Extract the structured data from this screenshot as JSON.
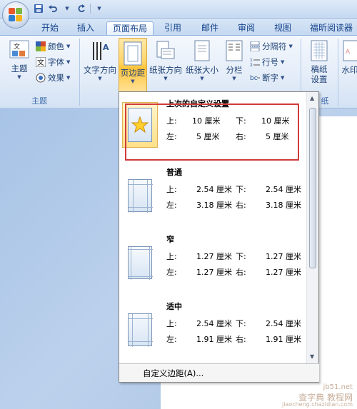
{
  "tabs": [
    "开始",
    "插入",
    "页面布局",
    "引用",
    "邮件",
    "审阅",
    "视图",
    "福昕阅读器"
  ],
  "active_tab": "页面布局",
  "ribbon": {
    "theme_button": "主题",
    "theme_items": [
      "颜色",
      "字体",
      "效果"
    ],
    "theme_group_label": "主题",
    "text_direction": "文字方向",
    "margins": "页边距",
    "orientation": "纸张方向",
    "size": "纸张大小",
    "columns": "分栏",
    "breaks": "分隔符",
    "line_numbers": "行号",
    "hyphenation": "断字",
    "draft_paper": "稿纸设置",
    "draft_group_label": "纸",
    "watermark": "水印"
  },
  "dropdown": {
    "presets": [
      {
        "name": "上次的自定义设置",
        "top_label": "上:",
        "top": "10 厘米",
        "bottom_label": "下:",
        "bottom": "10 厘米",
        "left_label": "左:",
        "left": "5 厘米",
        "right_label": "右:",
        "right": "5 厘米"
      },
      {
        "name": "普通",
        "top_label": "上:",
        "top": "2.54 厘米",
        "bottom_label": "下:",
        "bottom": "2.54 厘米",
        "left_label": "左:",
        "left": "3.18 厘米",
        "right_label": "右:",
        "right": "3.18 厘米"
      },
      {
        "name": "窄",
        "top_label": "上:",
        "top": "1.27 厘米",
        "bottom_label": "下:",
        "bottom": "1.27 厘米",
        "left_label": "左:",
        "left": "1.27 厘米",
        "right_label": "右:",
        "right": "1.27 厘米"
      },
      {
        "name": "适中",
        "top_label": "上:",
        "top": "2.54 厘米",
        "bottom_label": "下:",
        "bottom": "2.54 厘米",
        "left_label": "左:",
        "left": "1.91 厘米",
        "right_label": "右:",
        "right": "1.91 厘米"
      }
    ],
    "custom_margins": "自定义边距(A)..."
  },
  "watermark_text": [
    "jb51.net",
    "查字典 教程网",
    "jiaocheng.chazidian.com"
  ],
  "colors": {
    "highlight": "#ffd467",
    "red_box": "#d13a3a",
    "tab_text": "#15428b"
  }
}
